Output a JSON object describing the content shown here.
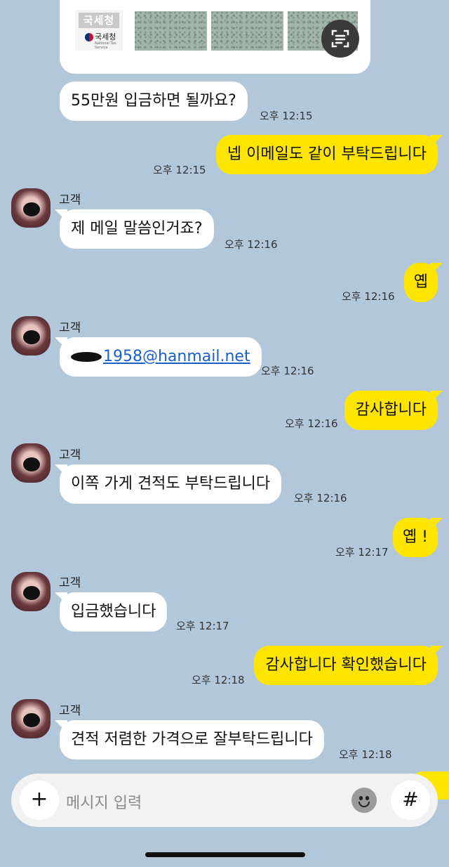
{
  "attachment": {
    "stamp_text": "국세청",
    "logo_label": "국세청",
    "logo_sub": "National Tax Service"
  },
  "messages": [
    {
      "id": "m1",
      "dir": "in",
      "text": "55만원 입금하면 될까요?",
      "time": "오후 12:15"
    },
    {
      "id": "m2",
      "dir": "out",
      "text": "넵 이메일도 같이 부탁드립니다",
      "time": "오후 12:15"
    },
    {
      "id": "m3",
      "dir": "in",
      "sender": "고객",
      "text": "제 메일 말씀인거죠?",
      "time": "오후 12:16"
    },
    {
      "id": "m4",
      "dir": "out",
      "text": "옙",
      "time": "오후 12:16"
    },
    {
      "id": "m5",
      "dir": "in",
      "sender": "고객",
      "text": "1958@hanmail.net",
      "time": "오후 12:16"
    },
    {
      "id": "m6",
      "dir": "out",
      "text": "감사합니다",
      "time": "오후 12:16"
    },
    {
      "id": "m7",
      "dir": "in",
      "sender": "고객",
      "text": "이쪽 가게 견적도 부탁드립니다",
      "time": "오후 12:16"
    },
    {
      "id": "m8",
      "dir": "out",
      "text": "옙 !",
      "time": "오후 12:17"
    },
    {
      "id": "m9",
      "dir": "in",
      "sender": "고객",
      "text": "입금했습니다",
      "time": "오후 12:17"
    },
    {
      "id": "m10",
      "dir": "out",
      "text": "감사합니다 확인했습니다",
      "time": "오후 12:18"
    },
    {
      "id": "m11",
      "dir": "in",
      "sender": "고객",
      "text": "견적 저렴한 가격으로 잘부탁드립니다",
      "time": "오후 12:18"
    }
  ],
  "input": {
    "placeholder": "메시지 입력",
    "add_icon": "+",
    "hash_icon": "#"
  },
  "colors": {
    "background": "#b2c7da",
    "incoming_bubble": "#ffffff",
    "outgoing_bubble": "#fee500",
    "link": "#1a5fc9"
  }
}
